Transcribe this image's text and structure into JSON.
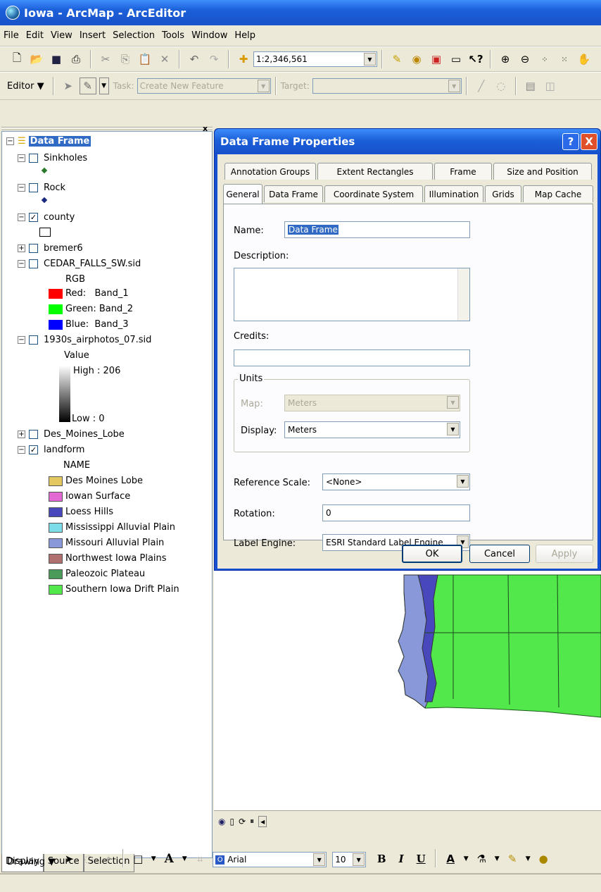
{
  "window": {
    "title": "Iowa - ArcMap - ArcEditor"
  },
  "menu": [
    "File",
    "Edit",
    "View",
    "Insert",
    "Selection",
    "Tools",
    "Window",
    "Help"
  ],
  "toolbar": {
    "scale": "1:2,346,561"
  },
  "editor": {
    "label": "Editor ▼",
    "task_label": "Task:",
    "task_value": "Create New Feature",
    "target_label": "Target:"
  },
  "toc": {
    "data_frame": "Data Frame",
    "layers": [
      {
        "name": "Sinkholes",
        "checked": false
      },
      {
        "name": "Rock",
        "checked": false
      },
      {
        "name": "county",
        "checked": true
      },
      {
        "name": "bremer6",
        "checked": false
      },
      {
        "name": "CEDAR_FALLS_SW.sid",
        "checked": false
      },
      {
        "name": "1930s_airphotos_07.sid",
        "checked": false
      },
      {
        "name": "Des_Moines_Lobe",
        "checked": false
      },
      {
        "name": "landform",
        "checked": true
      }
    ],
    "rgb": {
      "header": "RGB",
      "red": "Red:   Band_1",
      "green": "Green: Band_2",
      "blue": "Blue:  Band_3"
    },
    "value": {
      "header": "Value",
      "high": "High : 206",
      "low": "Low : 0"
    },
    "landform_header": "NAME",
    "landform_classes": [
      {
        "label": "Des Moines Lobe",
        "color": "#e2c85e"
      },
      {
        "label": "Iowan Surface",
        "color": "#e368d4"
      },
      {
        "label": "Loess Hills",
        "color": "#4848bc"
      },
      {
        "label": "Mississippi Alluvial Plain",
        "color": "#7cdde8"
      },
      {
        "label": "Missouri Alluvial Plain",
        "color": "#8898d8"
      },
      {
        "label": "Northwest Iowa Plains",
        "color": "#b07070"
      },
      {
        "label": "Paleozoic Plateau",
        "color": "#4a9a5a"
      },
      {
        "label": "Southern Iowa Drift Plain",
        "color": "#52e84c"
      }
    ],
    "tabs": [
      "Display",
      "Source",
      "Selection"
    ]
  },
  "dialog": {
    "title": "Data Frame Properties",
    "help": "?",
    "close": "X",
    "tabs_row1": [
      "Annotation Groups",
      "Extent Rectangles",
      "Frame",
      "Size and Position"
    ],
    "tabs_row2": [
      "General",
      "Data Frame",
      "Coordinate System",
      "Illumination",
      "Grids",
      "Map Cache"
    ],
    "name_label": "Name:",
    "name_value": "Data Frame",
    "description_label": "Description:",
    "credits_label": "Credits:",
    "units_group": "Units",
    "map_label": "Map:",
    "map_value": "Meters",
    "display_label": "Display:",
    "display_value": "Meters",
    "refscale_label": "Reference Scale:",
    "refscale_value": "<None>",
    "rotation_label": "Rotation:",
    "rotation_value": "0",
    "labelengine_label": "Label Engine:",
    "labelengine_value": "ESRI Standard Label Engine",
    "ok": "OK",
    "cancel": "Cancel",
    "apply": "Apply"
  },
  "drawing": {
    "label": "Drawing ▼",
    "font": "Arial",
    "size": "10",
    "bold": "B",
    "italic": "I",
    "underline": "U",
    "text_icon": "A"
  },
  "colors": {
    "xp_blue": "#1b5fd9",
    "panel": "#ece9d8"
  }
}
